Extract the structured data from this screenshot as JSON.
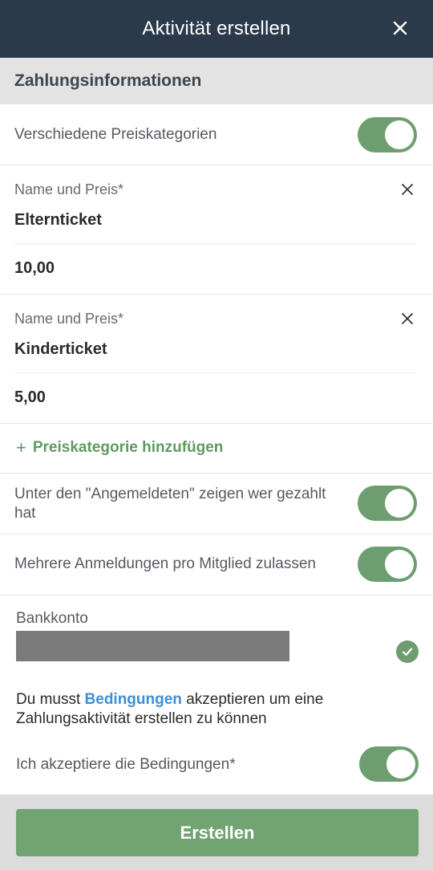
{
  "header": {
    "title": "Aktivität erstellen"
  },
  "section": {
    "title": "Zahlungsinformationen"
  },
  "price_categories_toggle": {
    "label": "Verschiedene Preiskategorien",
    "on": true
  },
  "price_entries": [
    {
      "label": "Name und Preis*",
      "name": "Elternticket",
      "price": "10,00"
    },
    {
      "label": "Name und Preis*",
      "name": "Kinderticket",
      "price": "5,00"
    }
  ],
  "add_category": {
    "plus": "+",
    "label": "Preiskategorie hinzufügen"
  },
  "show_paid_toggle": {
    "label": "Unter den \"Angemeldeten\" zeigen wer gezahlt hat",
    "on": true
  },
  "multiple_signups_toggle": {
    "label": "Mehrere Anmeldungen pro Mitglied zulassen",
    "on": true
  },
  "bank": {
    "label": "Bankkonto"
  },
  "terms": {
    "prefix": "Du musst ",
    "link": "Bedingungen",
    "suffix": " akzeptieren um eine Zahlungsaktivität erstellen zu können"
  },
  "accept_toggle": {
    "label": "Ich akzeptiere die Bedingungen*",
    "on": true
  },
  "footer": {
    "create_label": "Erstellen"
  },
  "colors": {
    "header_bg": "#2a3a4b",
    "accent_green": "#6e9e70",
    "link_blue": "#3d8fd6"
  }
}
